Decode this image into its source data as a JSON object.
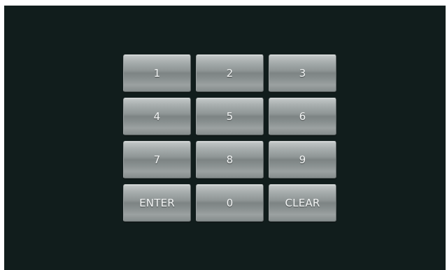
{
  "keypad": {
    "keys": [
      {
        "label": "1"
      },
      {
        "label": "2"
      },
      {
        "label": "3"
      },
      {
        "label": "4"
      },
      {
        "label": "5"
      },
      {
        "label": "6"
      },
      {
        "label": "7"
      },
      {
        "label": "8"
      },
      {
        "label": "9"
      },
      {
        "label": "ENTER"
      },
      {
        "label": "0"
      },
      {
        "label": "CLEAR"
      }
    ]
  },
  "colors": {
    "background": "#111d1c",
    "key_text": "#f4f6f6",
    "key_face": "#8f9696"
  }
}
